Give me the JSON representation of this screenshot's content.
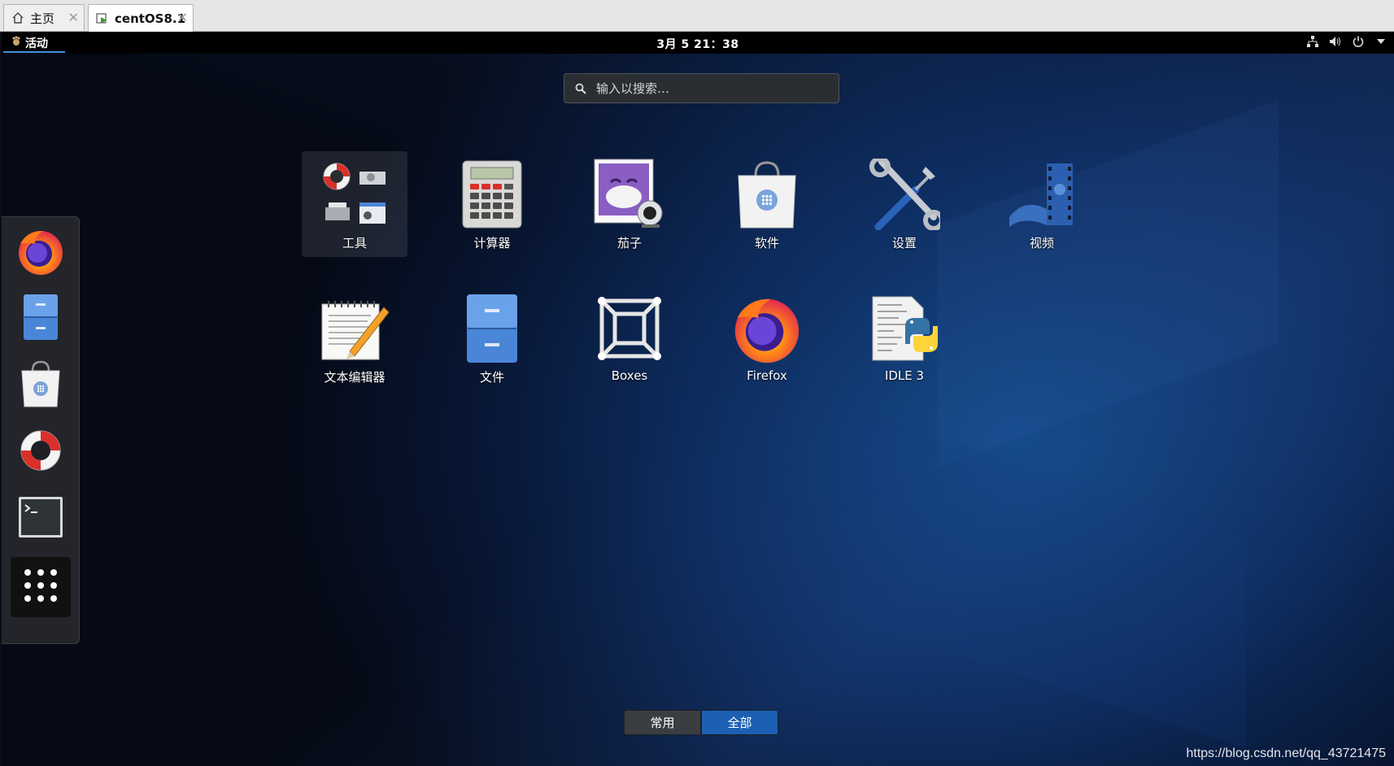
{
  "vm_tabs": [
    {
      "label": "主页",
      "icon": "home-icon"
    },
    {
      "label": "centOS8.1",
      "icon": "vm-icon"
    }
  ],
  "topbar": {
    "activities": "活动",
    "clock": "3月 5 21：38",
    "tray_icons": [
      "network-icon",
      "volume-icon",
      "power-icon",
      "chevron-down-icon"
    ]
  },
  "search": {
    "placeholder": "输入以搜索…"
  },
  "dash": {
    "items": [
      "Firefox",
      "文件",
      "软件",
      "帮助",
      "终端",
      "显示应用程序"
    ]
  },
  "apps": [
    {
      "label": "工具",
      "icon": "utilities-folder-icon"
    },
    {
      "label": "计算器",
      "icon": "calculator-icon"
    },
    {
      "label": "茄子",
      "icon": "cheese-icon"
    },
    {
      "label": "软件",
      "icon": "software-icon"
    },
    {
      "label": "设置",
      "icon": "settings-icon"
    },
    {
      "label": "视频",
      "icon": "video-icon"
    },
    {
      "label": "文本编辑器",
      "icon": "text-editor-icon"
    },
    {
      "label": "文件",
      "icon": "files-icon"
    },
    {
      "label": "Boxes",
      "icon": "boxes-icon"
    },
    {
      "label": "Firefox",
      "icon": "firefox-icon"
    },
    {
      "label": "IDLE 3",
      "icon": "idle-python-icon"
    }
  ],
  "switcher": {
    "frequent": "常用",
    "all": "全部",
    "selected": "全部"
  },
  "watermark": "https://blog.csdn.net/qq_43721475",
  "colors": {
    "accent": "#1b60b4",
    "topbar": "#000000"
  }
}
